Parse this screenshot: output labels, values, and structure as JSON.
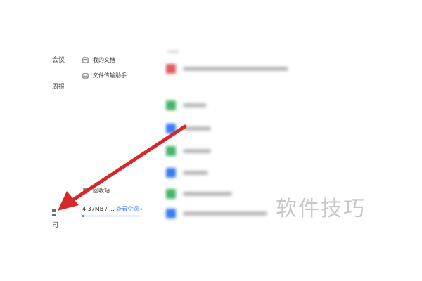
{
  "left_rail": {
    "items": [
      {
        "label": "会议"
      },
      {
        "label": "周报"
      },
      {
        "label": "司"
      }
    ]
  },
  "sidebar": {
    "items": [
      {
        "label": "我的文档",
        "icon": "document-icon"
      },
      {
        "label": "文件传输助手",
        "icon": "transfer-icon"
      },
      {
        "label": "回收站",
        "icon": "trash-icon"
      }
    ],
    "storage": {
      "used": "4.37MB / ...",
      "link_label": "查看空间",
      "link_suffix": "›",
      "used_fraction": 0.03
    }
  },
  "main": {
    "files": [
      {
        "icon": "file-icon",
        "color": "#e25a5a"
      },
      {
        "icon": "file-icon",
        "color": "#45b56b"
      },
      {
        "icon": "file-icon",
        "color": "#3b7cf0"
      },
      {
        "icon": "file-icon",
        "color": "#45b56b"
      },
      {
        "icon": "file-icon",
        "color": "#3b7cf0"
      },
      {
        "icon": "file-icon",
        "color": "#45b56b"
      },
      {
        "icon": "file-icon",
        "color": "#3b7cf0"
      }
    ]
  },
  "watermark": "软件技巧",
  "annotation": {
    "arrow_color": "#d62828"
  }
}
